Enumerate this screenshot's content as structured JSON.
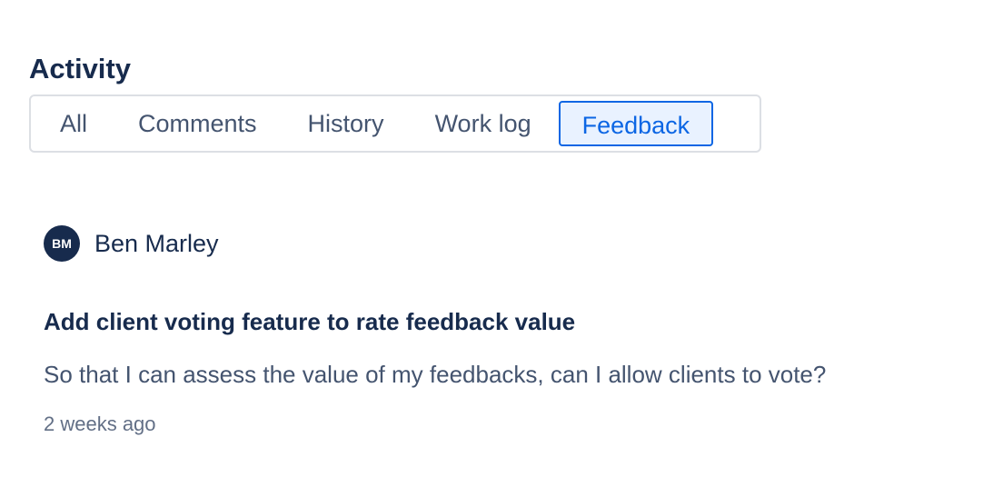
{
  "activity": {
    "title": "Activity",
    "tabs": [
      {
        "label": "All",
        "active": false
      },
      {
        "label": "Comments",
        "active": false
      },
      {
        "label": "History",
        "active": false
      },
      {
        "label": "Work log",
        "active": false
      },
      {
        "label": "Feedback",
        "active": true
      }
    ]
  },
  "feedback_item": {
    "author": {
      "initials": "BM",
      "name": "Ben Marley"
    },
    "title": "Add client voting feature to rate feedback value",
    "body": "So that I can assess the value of my feedbacks, can I allow clients to vote?",
    "timestamp": "2 weeks ago"
  },
  "colors": {
    "text_primary": "#172b4d",
    "text_secondary": "#44546f",
    "text_subtle": "#626f86",
    "accent": "#0c66e4",
    "accent_bg": "#e9f2ff",
    "border": "#dcdfe4"
  }
}
